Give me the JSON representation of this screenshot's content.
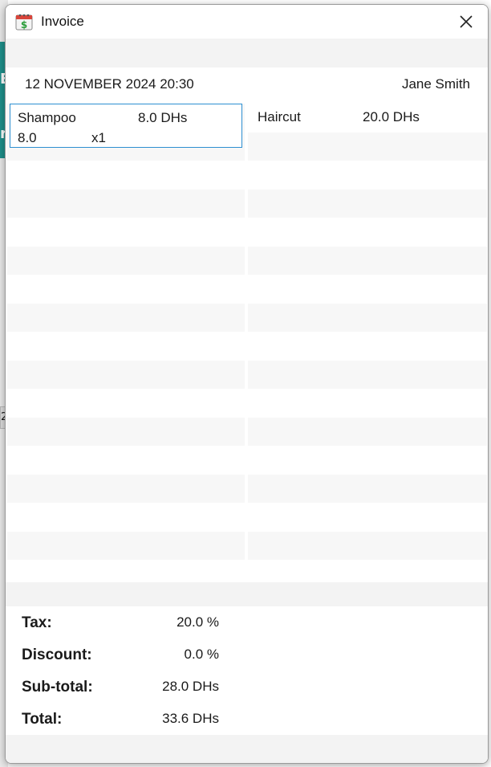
{
  "window": {
    "title": "Invoice",
    "icon": "invoice-calendar-dollar-icon"
  },
  "header": {
    "date": "12 NOVEMBER 2024 20:30",
    "user": "Jane Smith"
  },
  "background": {
    "teal_fragments": [
      "E",
      "r"
    ],
    "chip_text": "2"
  },
  "products": [
    {
      "name": "Shampoo",
      "price": "8.0 DHs",
      "unit_price": "8.0",
      "quantity": "x1"
    }
  ],
  "services": [
    {
      "name": "Haircut",
      "price": "20.0 DHs"
    }
  ],
  "totals": {
    "tax_label": "Tax:",
    "tax_value": "20.0 %",
    "discount_label": "Discount:",
    "discount_value": "0.0 %",
    "subtotal_label": "Sub-total:",
    "subtotal_value": "28.0 DHs",
    "total_label": "Total:",
    "total_value": "33.6 DHs"
  },
  "colors": {
    "selection_border": "#2d8fd1",
    "stripe": "#f7f7f7",
    "teal": "#1f8f8a"
  }
}
